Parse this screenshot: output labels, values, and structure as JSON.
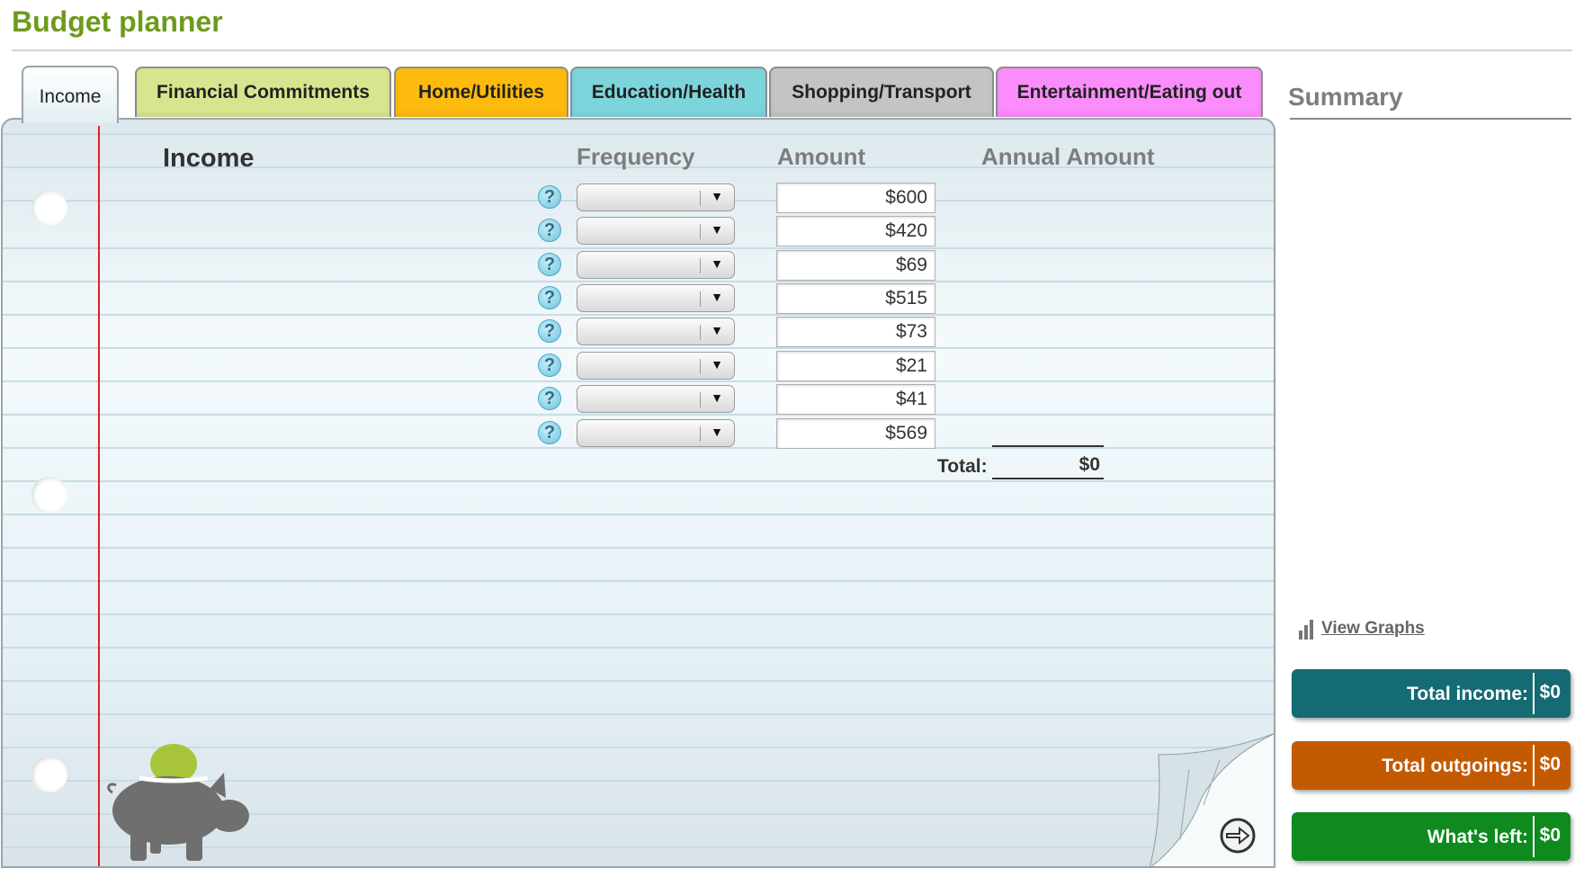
{
  "app": {
    "title": "Budget planner",
    "title_color": "#6e9a1c"
  },
  "tabs": [
    {
      "label": "Income",
      "color": "#e4f0f4",
      "active": true
    },
    {
      "label": "Financial Commitments",
      "color": "#d9e48e",
      "active": false
    },
    {
      "label": "Home/Utilities",
      "color": "#fdbb0e",
      "active": false
    },
    {
      "label": "Education/Health",
      "color": "#7dd5dc",
      "active": false
    },
    {
      "label": "Shopping/Transport",
      "color": "#c4c4c4",
      "active": false
    },
    {
      "label": "Entertainment/Eating out",
      "color": "#fb8cfb",
      "active": false
    }
  ],
  "income": {
    "section_title": "Income",
    "columns": {
      "frequency": "Frequency",
      "amount": "Amount",
      "annual": "Annual Amount"
    },
    "rows": [
      {
        "frequency": "",
        "amount": "$600",
        "annual": ""
      },
      {
        "frequency": "",
        "amount": "$420",
        "annual": ""
      },
      {
        "frequency": "",
        "amount": "$69",
        "annual": ""
      },
      {
        "frequency": "",
        "amount": "$515",
        "annual": ""
      },
      {
        "frequency": "",
        "amount": "$73",
        "annual": ""
      },
      {
        "frequency": "",
        "amount": "$21",
        "annual": ""
      },
      {
        "frequency": "",
        "amount": "$41",
        "annual": ""
      },
      {
        "frequency": "",
        "amount": "$569",
        "annual": ""
      }
    ],
    "help_glyph": "?",
    "dropdown_arrow": "▼",
    "total_label": "Total:",
    "total_value": "$0"
  },
  "summary": {
    "title": "Summary",
    "view_graphs": "View Graphs",
    "total_income": {
      "label": "Total income:",
      "value": "$0",
      "color": "#156b73"
    },
    "total_outgoings": {
      "label": "Total outgoings:",
      "value": "$0",
      "color": "#c45a00"
    },
    "whats_left": {
      "label": "What's left:",
      "value": "$0",
      "color": "#0e8a1f"
    }
  },
  "icons": {
    "help": "question-circle-icon",
    "dropdown": "chevron-down-icon",
    "graphs": "bar-chart-icon",
    "next_page": "arrow-right-icon",
    "mascot": "piggy-bank-icon"
  }
}
